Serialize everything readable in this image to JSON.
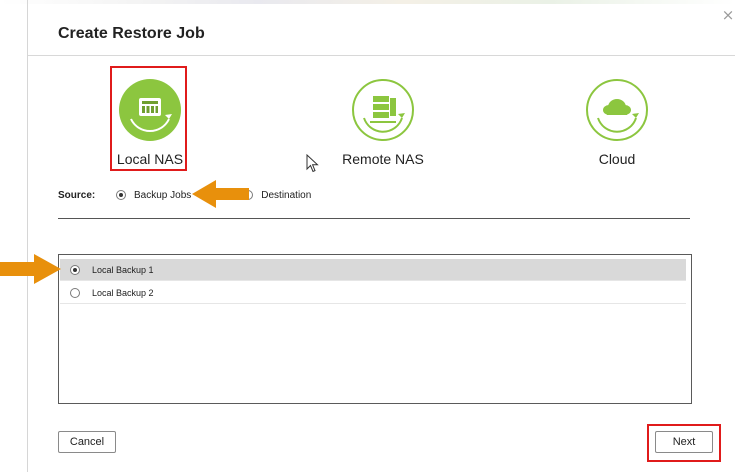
{
  "dialog": {
    "title": "Create Restore Job",
    "close_glyph": "×"
  },
  "restore_types": [
    {
      "label": "Local NAS",
      "icon": "nas-device-icon",
      "selected": true
    },
    {
      "label": "Remote NAS",
      "icon": "remote-server-icon",
      "selected": false
    },
    {
      "label": "Cloud",
      "icon": "cloud-icon",
      "selected": false
    }
  ],
  "source": {
    "label": "Source:",
    "options": [
      {
        "label": "Backup Jobs",
        "checked": true
      },
      {
        "label": "Destination",
        "checked": false
      }
    ]
  },
  "jobs": [
    {
      "label": "Local Backup 1",
      "checked": true
    },
    {
      "label": "Local Backup 2",
      "checked": false
    }
  ],
  "buttons": {
    "cancel": "Cancel",
    "next": "Next"
  },
  "colors": {
    "accent_green": "#8cc63f",
    "highlight_red": "#e01b1b",
    "annotation_orange": "#e8900c"
  }
}
